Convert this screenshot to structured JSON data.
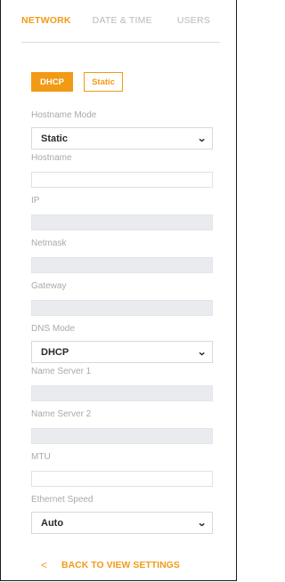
{
  "tabs": [
    {
      "label": "NETWORK",
      "active": true
    },
    {
      "label": "DATE & TIME",
      "active": false
    },
    {
      "label": "USERS",
      "active": false
    }
  ],
  "mode_buttons": {
    "dhcp": "DHCP",
    "static": "Static",
    "selected": "DHCP"
  },
  "fields": {
    "hostname_mode": {
      "label": "Hostname Mode",
      "value": "Static"
    },
    "hostname": {
      "label": "Hostname",
      "value": ""
    },
    "ip": {
      "label": "IP",
      "value": ""
    },
    "netmask": {
      "label": "Netmask",
      "value": ""
    },
    "gateway": {
      "label": "Gateway",
      "value": ""
    },
    "dns_mode": {
      "label": "DNS Mode",
      "value": "DHCP"
    },
    "name_server_1": {
      "label": "Name Server 1",
      "value": ""
    },
    "name_server_2": {
      "label": "Name Server 2",
      "value": ""
    },
    "mtu": {
      "label": "MTU",
      "value": ""
    },
    "ethernet_speed": {
      "label": "Ethernet Speed",
      "value": "Auto"
    }
  },
  "back": {
    "label": "BACK TO VIEW SETTINGS",
    "icon": "chevron-left-icon",
    "glyph": "<"
  },
  "colors": {
    "accent": "#f29a16",
    "input_disabled": "#e9ebee",
    "label": "#a9a9a9"
  }
}
